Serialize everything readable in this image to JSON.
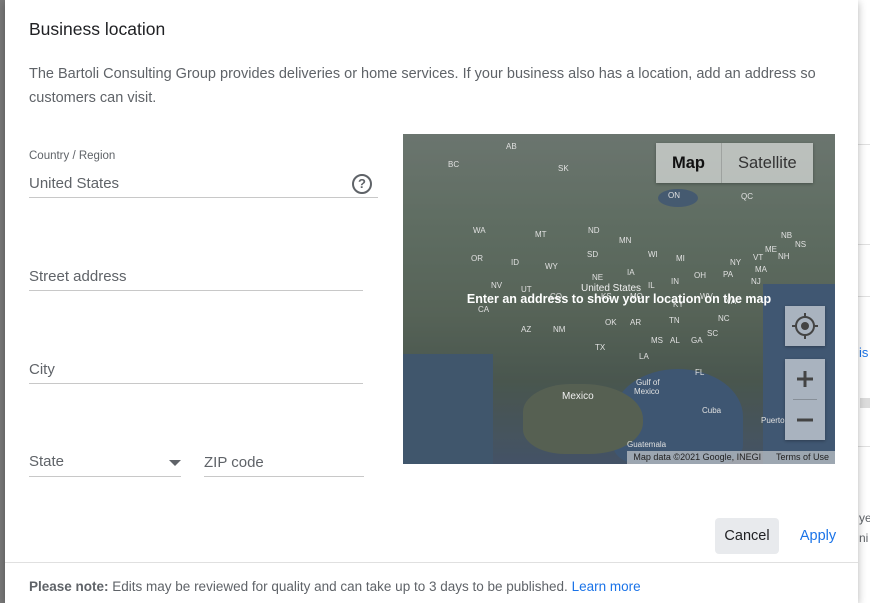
{
  "dialog": {
    "title": "Business location",
    "description": "The Bartoli Consulting Group provides deliveries or home services. If your business also has a location, add an address so customers can visit."
  },
  "form": {
    "country_label": "Country / Region",
    "country_value": "United States",
    "street_placeholder": "Street address",
    "city_placeholder": "City",
    "state_placeholder": "State",
    "zip_placeholder": "ZIP code"
  },
  "map": {
    "type_map": "Map",
    "type_satellite": "Satellite",
    "message": "Enter an address to show your location on the map",
    "attribution_data": "Map data ©2021 Google, INEGI",
    "attribution_terms": "Terms of Use",
    "labels": [
      "AB",
      "SK",
      "BC",
      "ON",
      "QC",
      "NB",
      "NS",
      "ND",
      "MN",
      "MT",
      "WA",
      "SD",
      "ME",
      "VT",
      "NH",
      "MA",
      "NY",
      "MI",
      "WI",
      "OR",
      "ID",
      "WY",
      "NE",
      "IA",
      "IL",
      "IN",
      "OH",
      "PA",
      "NJ",
      "United States",
      "NV",
      "UT",
      "CO",
      "KS",
      "MO",
      "KY",
      "WV",
      "VA",
      "CA",
      "AZ",
      "NM",
      "OK",
      "AR",
      "TN",
      "NC",
      "SC",
      "MS",
      "AL",
      "GA",
      "TX",
      "LA",
      "FL",
      "Mexico",
      "Gulf of",
      "Mexico",
      "Cuba",
      "Puerto",
      "Guatemala"
    ]
  },
  "actions": {
    "cancel": "Cancel",
    "apply": "Apply"
  },
  "footer": {
    "note_label": "Please note:",
    "note_text": " Edits may be reviewed for quality and can take up to 3 days to be published. ",
    "learn_more": "Learn more"
  },
  "background_fragments": {
    "right_1": "is",
    "right_2": "ye",
    "right_3": "ni"
  }
}
